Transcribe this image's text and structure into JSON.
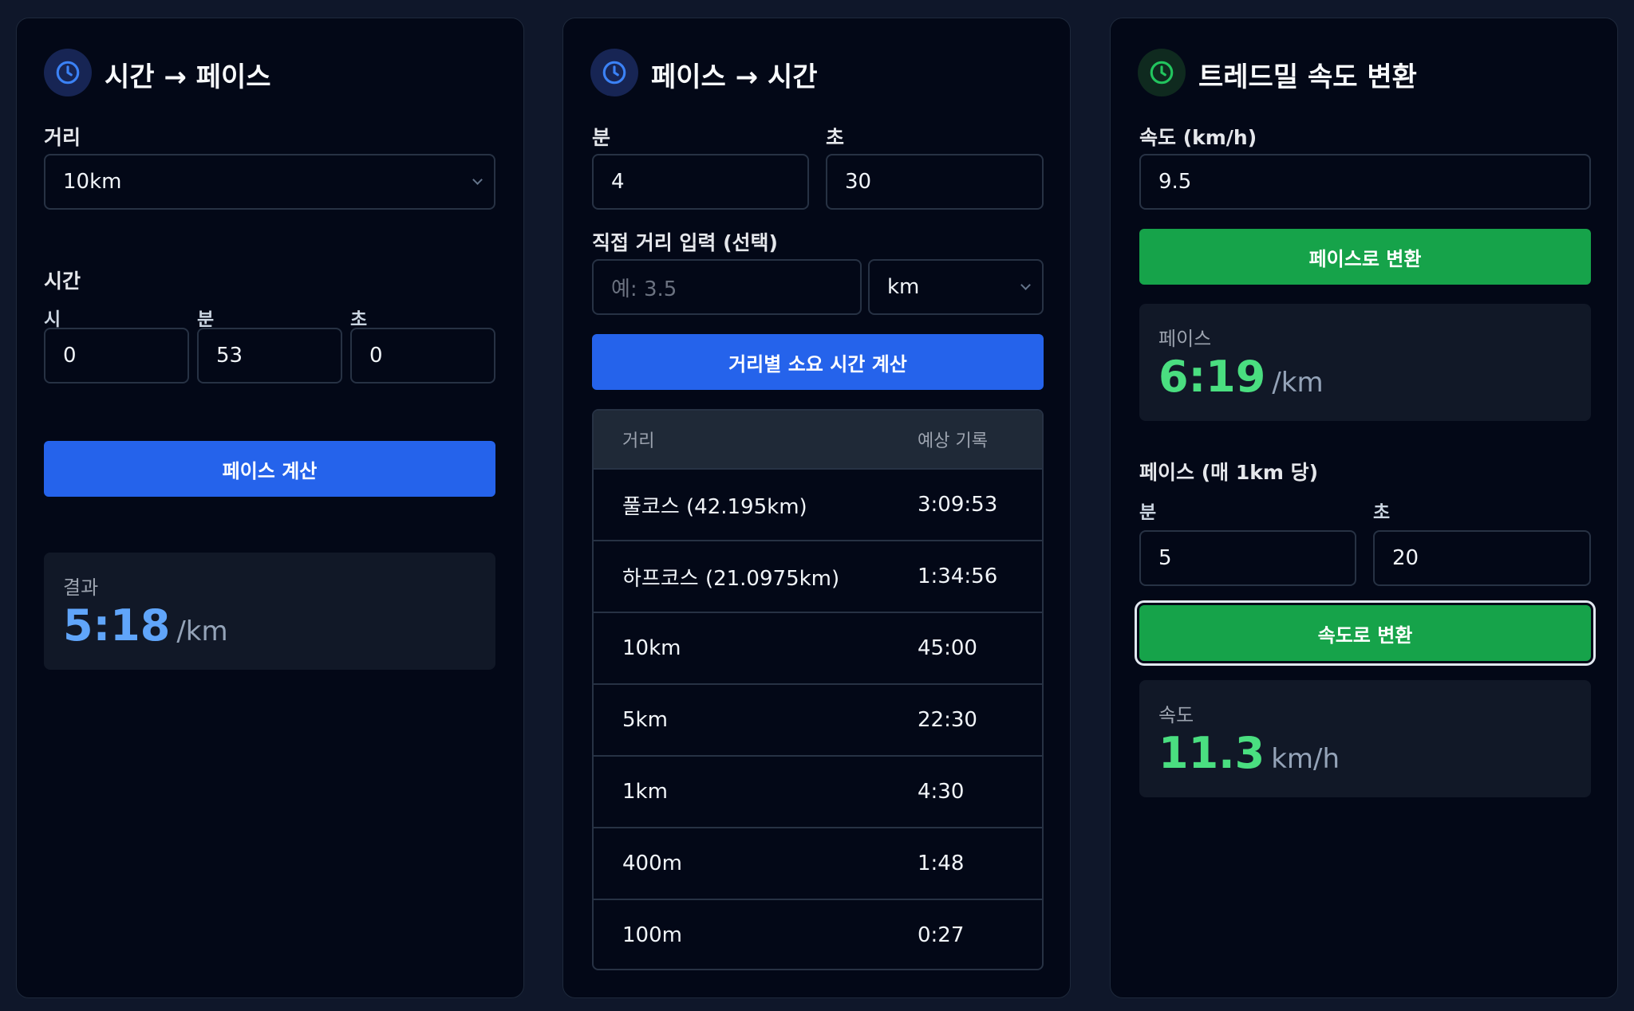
{
  "colors": {
    "accent_blue": "#2563eb",
    "accent_green": "#16a34a",
    "result_blue": "#60a5fa",
    "result_green": "#4ade80"
  },
  "time_to_pace": {
    "title": "시간 → 페이스",
    "icon": "clock-icon",
    "distance_label": "거리",
    "distance_value": "10km",
    "time_label": "시간",
    "hours_label": "시",
    "minutes_label": "분",
    "seconds_label": "초",
    "hours_value": "0",
    "minutes_value": "53",
    "seconds_value": "0",
    "button_label": "페이스 계산",
    "result_label": "결과",
    "result_value": "5:18",
    "result_unit": "/km"
  },
  "pace_to_time": {
    "title": "페이스 → 시간",
    "icon": "clock-icon",
    "minutes_label": "분",
    "seconds_label": "초",
    "minutes_value": "4",
    "seconds_value": "30",
    "custom_distance_label": "직접 거리 입력 (선택)",
    "custom_distance_placeholder": "예: 3.5",
    "unit_value": "km",
    "button_label": "거리별 소요 시간 계산",
    "table": {
      "headers": [
        "거리",
        "예상 기록"
      ],
      "rows": [
        {
          "distance": "풀코스 (42.195km)",
          "time": "3:09:53"
        },
        {
          "distance": "하프코스 (21.0975km)",
          "time": "1:34:56"
        },
        {
          "distance": "10km",
          "time": "45:00"
        },
        {
          "distance": "5km",
          "time": "22:30"
        },
        {
          "distance": "1km",
          "time": "4:30"
        },
        {
          "distance": "400m",
          "time": "1:48"
        },
        {
          "distance": "100m",
          "time": "0:27"
        }
      ]
    }
  },
  "treadmill": {
    "title": "트레드밀 속도 변환",
    "icon": "clock-icon",
    "speed_label": "속도 (km/h)",
    "speed_value": "9.5",
    "to_pace_button": "페이스로 변환",
    "pace_result_label": "페이스",
    "pace_result_value": "6:19",
    "pace_result_unit": "/km",
    "pace_input_label": "페이스 (매 1km 당)",
    "minutes_label": "분",
    "seconds_label": "초",
    "minutes_value": "5",
    "seconds_value": "20",
    "to_speed_button": "속도로 변환",
    "speed_result_label": "속도",
    "speed_result_value": "11.3",
    "speed_result_unit": "km/h"
  }
}
